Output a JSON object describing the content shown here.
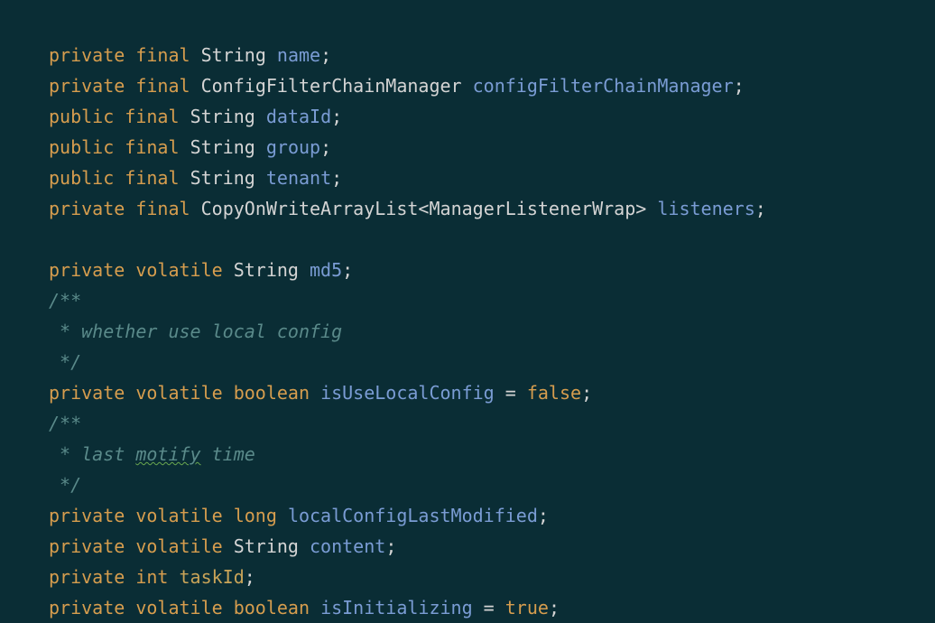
{
  "lines": {
    "l1": {
      "access": "private",
      "mod": "final",
      "type": "String",
      "name": "name",
      "semi": ";"
    },
    "l2": {
      "access": "private",
      "mod": "final",
      "type": "ConfigFilterChainManager",
      "name": "configFilterChainManager",
      "semi": ";"
    },
    "l3": {
      "access": "public",
      "mod": "final",
      "type": "String",
      "name": "dataId",
      "semi": ";"
    },
    "l4": {
      "access": "public",
      "mod": "final",
      "type": "String",
      "name": "group",
      "semi": ";"
    },
    "l5": {
      "access": "public",
      "mod": "final",
      "type": "String",
      "name": "tenant",
      "semi": ";"
    },
    "l6": {
      "access": "private",
      "mod": "final",
      "type_pre": "CopyOnWriteArrayList<",
      "type_param": "ManagerListenerWrap",
      "type_post": ">",
      "name": "listeners",
      "semi": ";"
    },
    "l7": {
      "access": "private",
      "mod": "volatile",
      "type": "String",
      "name": "md5",
      "semi": ";"
    },
    "c1": {
      "open": "/**",
      "body": " * whether use local config",
      "close": " */"
    },
    "l8": {
      "access": "private",
      "mod": "volatile",
      "type": "boolean",
      "name": "isUseLocalConfig",
      "eq": " = ",
      "val": "false",
      "semi": ";"
    },
    "c2": {
      "open": "/**",
      "body_pre": " * last ",
      "body_warn": "motify",
      "body_post": " time",
      "close": " */"
    },
    "l9": {
      "access": "private",
      "mod": "volatile",
      "type": "long",
      "name": "localConfigLastModified",
      "semi": ";"
    },
    "l10": {
      "access": "private",
      "mod": "volatile",
      "type": "String",
      "name": "content",
      "semi": ";"
    },
    "l11": {
      "access": "private",
      "mod": "int",
      "name": "taskId",
      "semi": ";"
    },
    "l12": {
      "access": "private",
      "mod": "volatile",
      "type": "boolean",
      "name": "isInitializing",
      "eq": " = ",
      "val": "true",
      "semi": ";"
    }
  }
}
